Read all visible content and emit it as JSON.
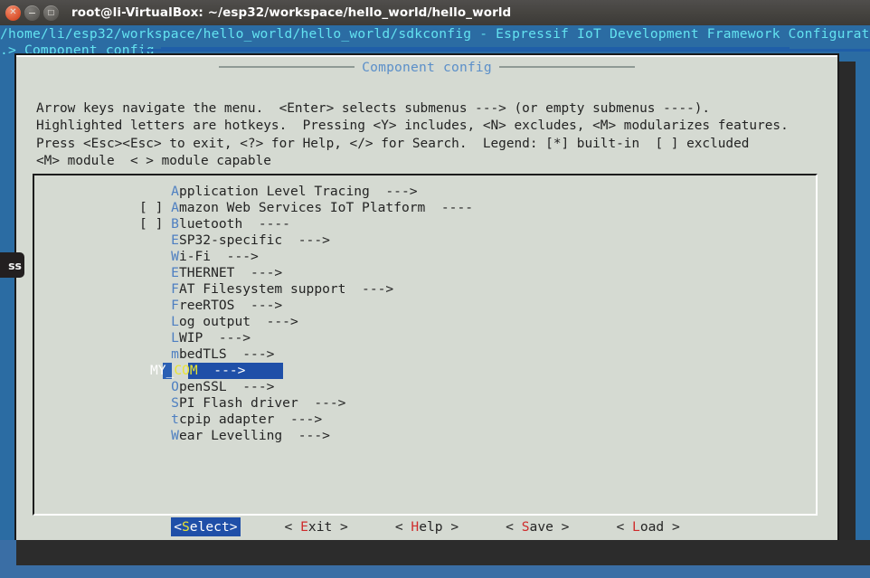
{
  "window": {
    "title": "root@li-VirtualBox: ~/esp32/workspace/hello_world/hello_world",
    "controls": {
      "close": "close-button",
      "minimize": "minimize-button",
      "maximize": "maximize-button",
      "close_glyph": "✕",
      "minimize_glyph": "−",
      "maximize_glyph": "□"
    }
  },
  "kconfig": {
    "header_path": "/home/li/esp32/workspace/hello_world/hello_world/sdkconfig",
    "header_separator": " - ",
    "header_description": "Espressif IoT Development Framework Configurat",
    "breadcrumb": ".> Component config"
  },
  "dialog": {
    "title": "Component config",
    "help_lines": [
      "Arrow keys navigate the menu.  <Enter> selects submenus ---> (or empty submenus ----).",
      "Highlighted letters are hotkeys.  Pressing <Y> includes, <N> excludes, <M> modularizes features.",
      "Press <Esc><Esc> to exit, <?> for Help, </> for Search.  Legend: [*] built-in  [ ] excluded",
      "<M> module  < > module capable"
    ]
  },
  "menu": {
    "items": [
      {
        "checkbox": "",
        "hotkey": "A",
        "label": "pplication Level Tracing",
        "arrow": "--->",
        "selected": false
      },
      {
        "checkbox": "[ ] ",
        "hotkey": "A",
        "label": "mazon Web Services IoT Platform",
        "arrow": "----",
        "selected": false
      },
      {
        "checkbox": "[ ] ",
        "hotkey": "B",
        "label": "luetooth",
        "arrow": "----",
        "selected": false
      },
      {
        "checkbox": "",
        "hotkey": "E",
        "label": "SP32-specific",
        "arrow": "--->",
        "selected": false
      },
      {
        "checkbox": "",
        "hotkey": "W",
        "label": "i-Fi",
        "arrow": "--->",
        "selected": false
      },
      {
        "checkbox": "",
        "hotkey": "E",
        "label": "THERNET",
        "arrow": "--->",
        "selected": false
      },
      {
        "checkbox": "",
        "hotkey": "F",
        "label": "AT Filesystem support",
        "arrow": "--->",
        "selected": false
      },
      {
        "checkbox": "",
        "hotkey": "F",
        "label": "reeRTOS",
        "arrow": "--->",
        "selected": false
      },
      {
        "checkbox": "",
        "hotkey": "L",
        "label": "og output",
        "arrow": "--->",
        "selected": false
      },
      {
        "checkbox": "",
        "hotkey": "L",
        "label": "WIP",
        "arrow": "--->",
        "selected": false
      },
      {
        "checkbox": "",
        "hotkey": "m",
        "label": "bedTLS",
        "arrow": "--->",
        "selected": false
      },
      {
        "checkbox": "",
        "hotkey": "MY_",
        "label": "",
        "label2": "COM",
        "arrow": "--->",
        "selected": true,
        "full_label": "MY_COM"
      },
      {
        "checkbox": "",
        "hotkey": "O",
        "label": "penSSL",
        "arrow": "--->",
        "selected": false
      },
      {
        "checkbox": "",
        "hotkey": "S",
        "label": "PI Flash driver",
        "arrow": "--->",
        "selected": false
      },
      {
        "checkbox": "",
        "hotkey": "t",
        "label": "cpip adapter",
        "arrow": "--->",
        "selected": false
      },
      {
        "checkbox": "",
        "hotkey": "W",
        "label": "ear Levelling",
        "arrow": "--->",
        "selected": false
      }
    ]
  },
  "buttons": [
    {
      "name": "select",
      "prefix": "<",
      "hotkey": "S",
      "rest": "elect",
      "suffix": ">",
      "active": true
    },
    {
      "name": "exit",
      "prefix": "< ",
      "hotkey": "E",
      "rest": "xit",
      "suffix": " >",
      "active": false
    },
    {
      "name": "help",
      "prefix": "< ",
      "hotkey": "H",
      "rest": "elp",
      "suffix": " >",
      "active": false
    },
    {
      "name": "save",
      "prefix": "< ",
      "hotkey": "S",
      "rest": "ave",
      "suffix": " >",
      "active": false
    },
    {
      "name": "load",
      "prefix": "< ",
      "hotkey": "L",
      "rest": "oad",
      "suffix": " >",
      "active": false
    }
  ],
  "edge_tooltip": {
    "text": "ss"
  },
  "colors": {
    "terminal_bg": "#2b6ca3",
    "dialog_bg": "#d5dad2",
    "accent_cyan": "#63e2f0",
    "highlight_blue": "#1f4fa8",
    "hotkey_blue": "#4e7fc1",
    "hotkey_red": "#cf2b2b",
    "hotkey_yellow": "#e8e432",
    "desktop_bg": "#3a6ea5"
  }
}
